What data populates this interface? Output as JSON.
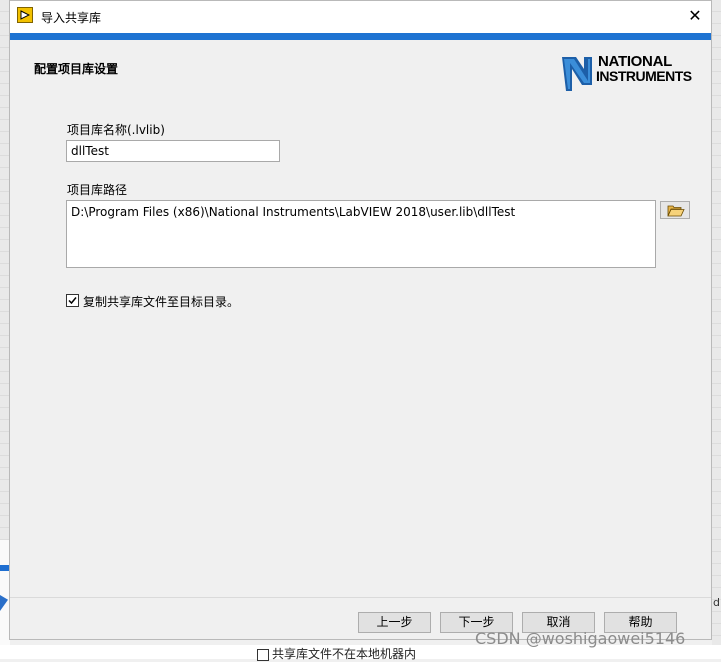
{
  "window": {
    "title": "导入共享库",
    "close_glyph": "✕"
  },
  "header": {
    "title": "配置项目库设置",
    "logo": {
      "line1": "NATIONAL",
      "line2": "INSTRUMENTS"
    }
  },
  "form": {
    "name_label": "项目库名称(.lvlib)",
    "name_value": "dllTest",
    "path_label": "项目库路径",
    "path_value": "D:\\Program Files (x86)\\National Instruments\\LabVIEW 2018\\user.lib\\dllTest",
    "browse_icon": "folder-open-icon",
    "copy_checkbox": {
      "checked": true,
      "label": "复制共享库文件至目标目录。"
    }
  },
  "buttons": {
    "prev": "上一步",
    "next": "下一步",
    "cancel": "取消",
    "help": "帮助"
  },
  "background": {
    "partial_text": "共享库文件不在本地机器内",
    "right_text": "dl"
  },
  "watermark": "CSDN @woshigaowei5146",
  "colors": {
    "accent": "#1e73d2",
    "titlebar_bg": "#ffffff",
    "dialog_bg": "#f0f0f0"
  }
}
